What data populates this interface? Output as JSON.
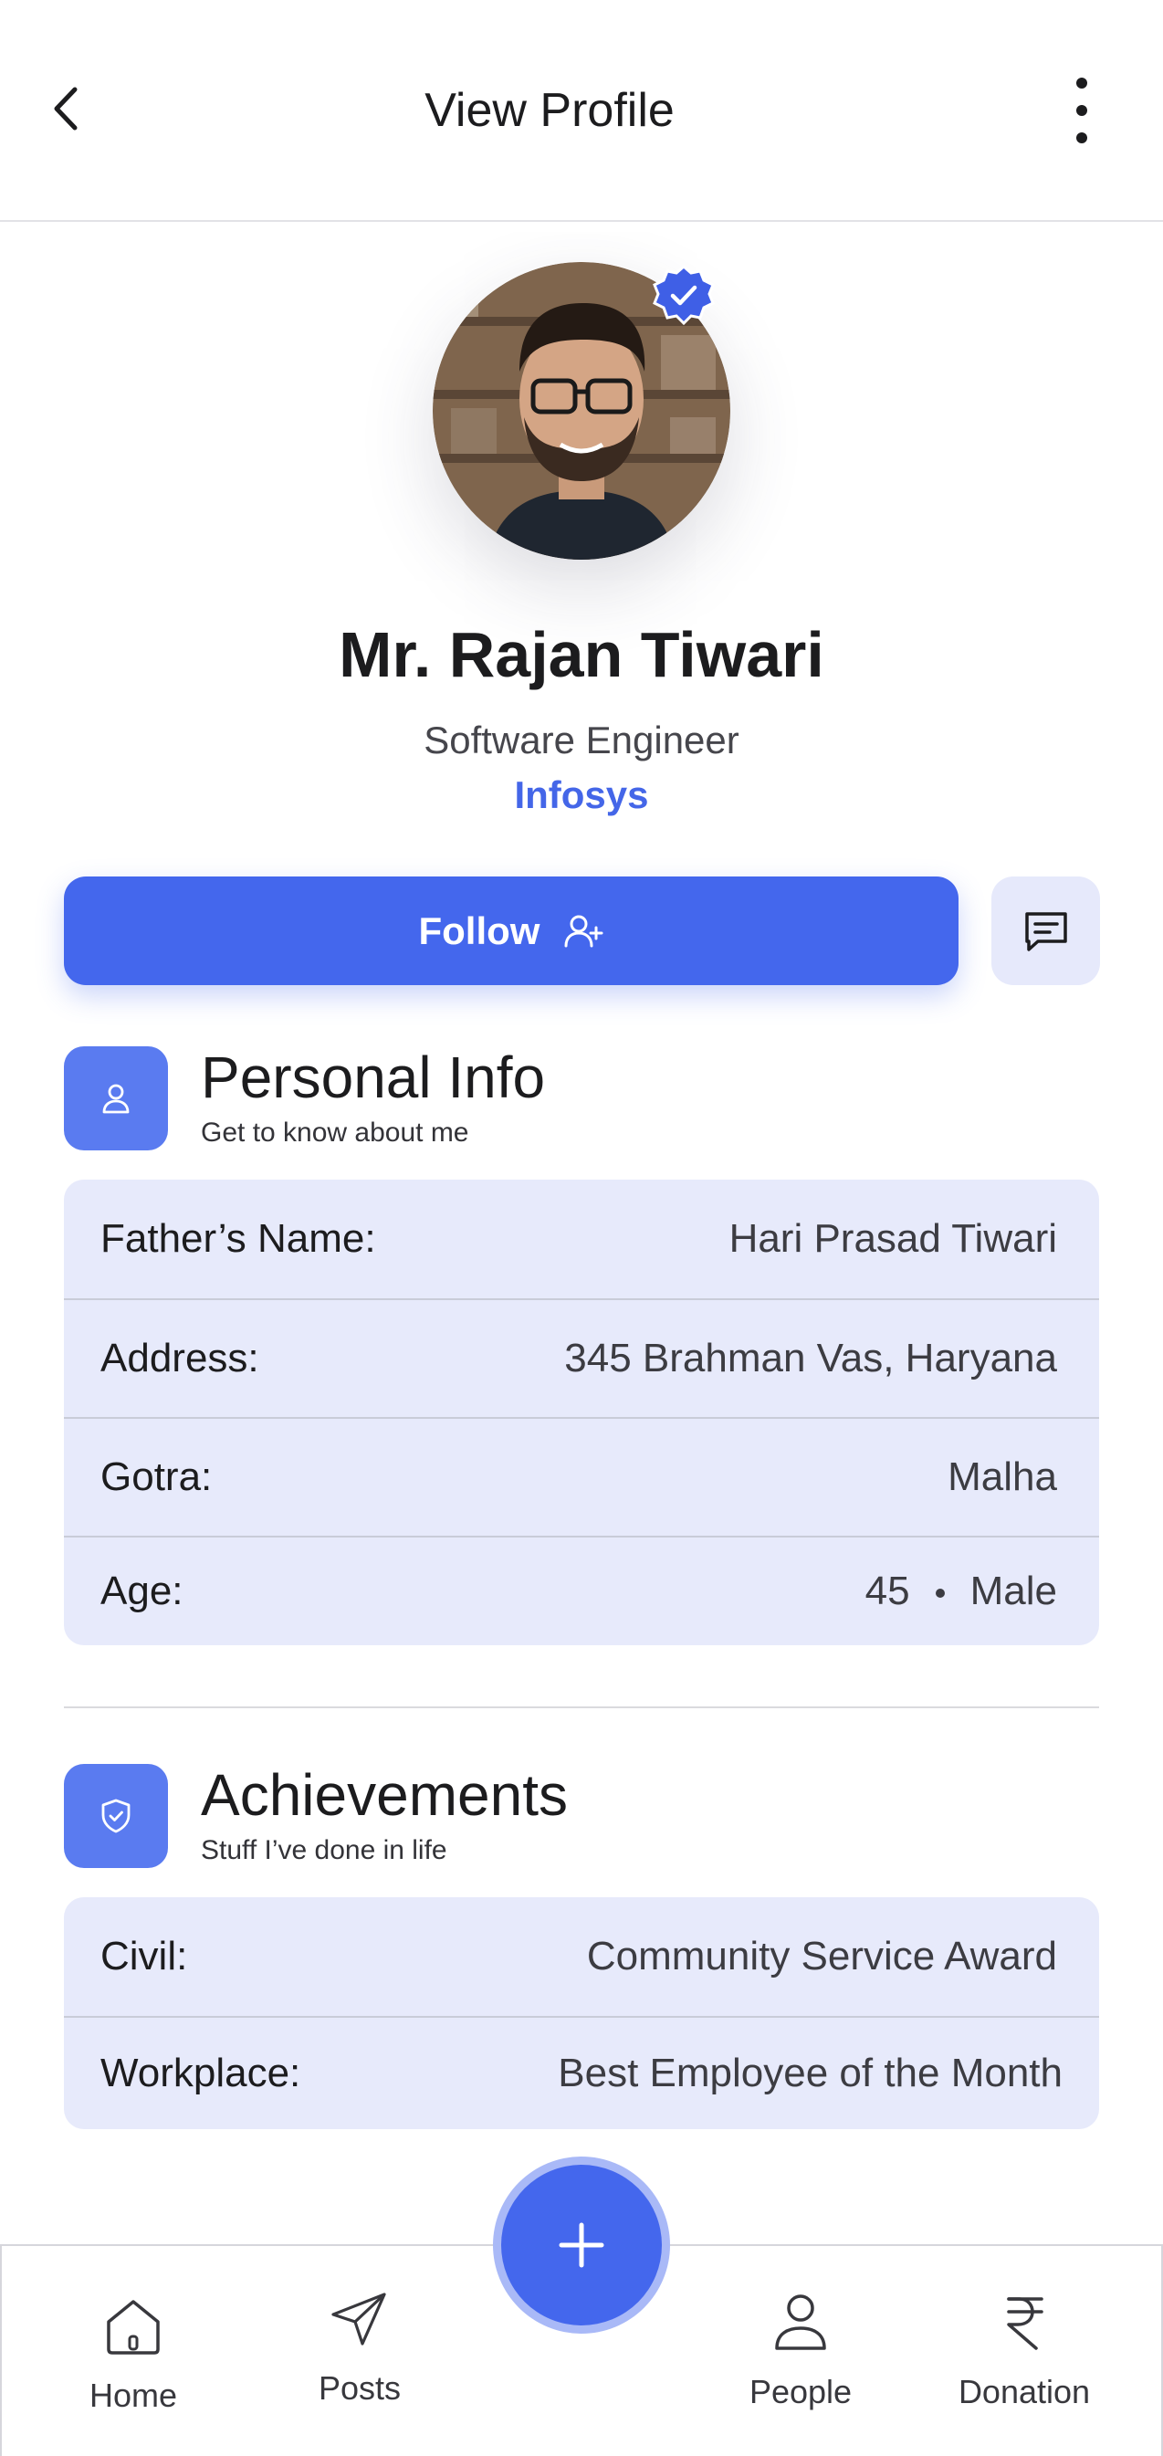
{
  "header": {
    "title": "View Profile",
    "back_icon": "chevron-left-icon",
    "more_icon": "more-vertical-icon"
  },
  "profile": {
    "name": "Mr. Rajan Tiwari",
    "role": "Software Engineer",
    "company": "Infosys",
    "verified": true
  },
  "actions": {
    "follow_label": "Follow",
    "follow_icon": "user-plus-icon",
    "message_icon": "message-icon"
  },
  "personal_info": {
    "title": "Personal Info",
    "subtitle": "Get to know about me",
    "rows": [
      {
        "label": "Father’s Name:",
        "value": "Hari Prasad Tiwari"
      },
      {
        "label": "Address:",
        "value": "345 Brahman Vas, Haryana"
      },
      {
        "label": "Gotra:",
        "value": "Malha"
      }
    ],
    "age_row": {
      "label": "Age:",
      "age": "45",
      "gender": "Male"
    }
  },
  "achievements": {
    "title": "Achievements",
    "subtitle": "Stuff I’ve done in life",
    "rows": [
      {
        "label": "Civil:",
        "value": "Community Service Award"
      },
      {
        "label": "Workplace:",
        "value": "Best Employee of the Month"
      }
    ]
  },
  "bottom_nav": {
    "items": [
      {
        "label": "Home",
        "icon": "home-icon"
      },
      {
        "label": "Posts",
        "icon": "send-icon"
      },
      {
        "label": "People",
        "icon": "user-icon"
      },
      {
        "label": "Donation",
        "icon": "rupee-icon"
      }
    ],
    "fab_icon": "plus-icon"
  },
  "colors": {
    "accent": "#4467ed",
    "card_bg": "#e7eafb",
    "section_icon_bg": "#5a7bf0"
  }
}
